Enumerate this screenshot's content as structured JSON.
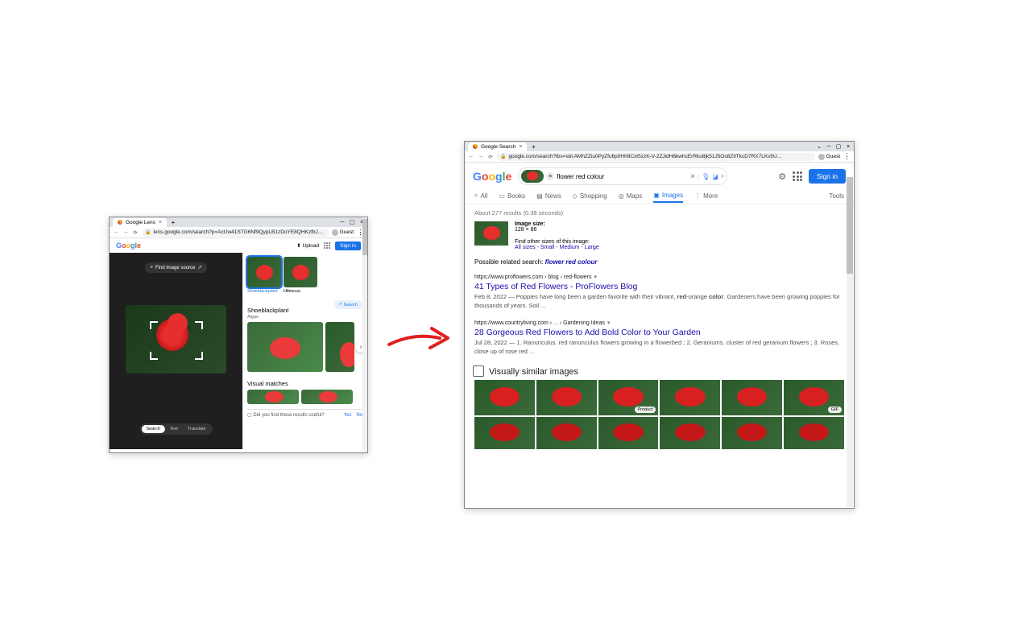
{
  "win1": {
    "tab": "Google Lens",
    "url": "lens.google.com/search?p=AcUw41STG6Nf9QypLB1zDoYE8QHKzfbJWMgrVwbdH67LX-j,$...",
    "guest": "Guest",
    "upload": "Upload",
    "signin": "Sign in",
    "find_source": "Find image source",
    "thumbs": [
      {
        "label": "Shoeblackplant",
        "active": true
      },
      {
        "label": "Hibiscus",
        "active": false
      }
    ],
    "section_title": "Shoeblackplant",
    "section_sub": "Algae",
    "search_chip": "Search",
    "visual_matches": "Visual matches",
    "pills": [
      "Search",
      "Text",
      "Translate"
    ],
    "feedback": "Did you find these results useful?",
    "yes": "Yes",
    "no": "No"
  },
  "win2": {
    "tab": "Google Search",
    "url": "google.com/search?tbs=sbi:AMhZZiu0PyZfu6p0Hh8Cxt5zzK-V-2ZJidH8kwhcErRku8jk51J5Os8ZIITkcD7RX7LKv5U...",
    "guest": "Guest",
    "query": "flower red colour",
    "signin": "Sign in",
    "tabs": [
      "All",
      "Books",
      "News",
      "Shopping",
      "Maps",
      "Images",
      "More"
    ],
    "tools": "Tools",
    "stats": "About 277 results (0.38 seconds)",
    "img_size_label": "Image size:",
    "img_size": "128 × 86",
    "find_other": "Find other sizes of this image:",
    "sizes": "All sizes - Small - Medium - Large",
    "related_label": "Possible related search:",
    "related_query": "flower red colour",
    "results": [
      {
        "crumb": "https://www.proflowers.com › blog › red-flowers",
        "title": "41 Types of Red Flowers - ProFlowers Blog",
        "snip_pre": "Feb 8, 2022 — Poppies have long been a garden favorite with their vibrant, ",
        "snip_b1": "red",
        "snip_mid": "-orange ",
        "snip_b2": "color",
        "snip_post": ". Gardeners have been growing poppies for thousands of years. Soil ..."
      },
      {
        "crumb": "https://www.countryliving.com › ... › Gardening Ideas",
        "title": "28 Gorgeous Red Flowers to Add Bold Color to Your Garden",
        "snip": "Jul 28, 2022 — 1. Ranunculus. red ranunculus flowers growing in a flowerbed ; 2. Geraniums. cluster of red geranium flowers ; 3. Roses. close up of rose red ..."
      }
    ],
    "visually_similar": "Visually similar images",
    "badge_product": "Product",
    "badge_gif": "GIF"
  }
}
